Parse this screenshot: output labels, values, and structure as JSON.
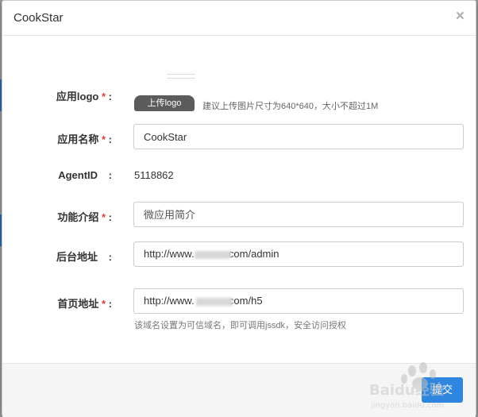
{
  "dialog": {
    "title": "CookStar",
    "close_glyph": "×"
  },
  "form": {
    "logo": {
      "label": "应用logo",
      "required_mark": "*",
      "colon": ":",
      "upload_label": "上传logo",
      "hint": "建议上传图片尺寸为640*640，大小不超过1M"
    },
    "app_name": {
      "label": "应用名称",
      "required_mark": "*",
      "colon": ":",
      "value": "CookStar"
    },
    "agent_id": {
      "label": "AgentID",
      "colon": ":",
      "value": "5118862"
    },
    "intro": {
      "label": "功能介绍",
      "required_mark": "*",
      "colon": ":",
      "placeholder": "微应用简介"
    },
    "admin_url": {
      "label": "后台地址",
      "colon": ":",
      "value": "http://www.           .com/admin"
    },
    "home_url": {
      "label": "首页地址",
      "required_mark": "*",
      "colon": ":",
      "value": "http://www.           .com/h5",
      "help": "该域名设置为可信域名，即可调用jssdk，安全访问授权"
    }
  },
  "footer": {
    "submit_label": "提交"
  },
  "watermark": {
    "text": "Baidu经验",
    "subtext": "jingyan.baidu.com"
  },
  "colors": {
    "required": "#e4393c",
    "primary_button": "#2e86de",
    "upload_button": "#5c5c5c"
  }
}
